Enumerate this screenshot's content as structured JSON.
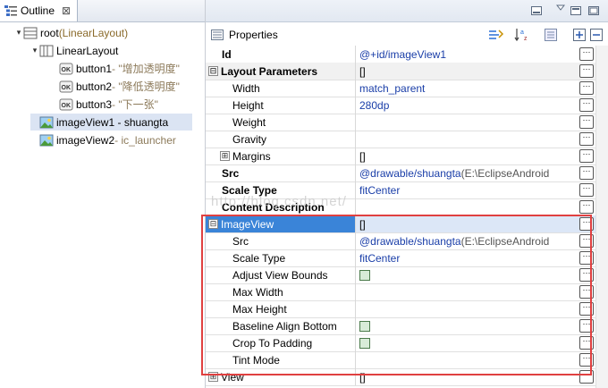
{
  "outline": {
    "tab_label": "Outline",
    "tab_close": "⊠",
    "tree": [
      {
        "label": "root",
        "sub": " (LinearLayout)",
        "indent": 0,
        "arrow": "▾",
        "icon": "layout-icon"
      },
      {
        "label": "LinearLayout",
        "sub": "",
        "indent": 1,
        "arrow": "▾",
        "icon": "linear-layout-icon"
      },
      {
        "label": "button1",
        "sub": " - \"增加透明度\"",
        "indent": 2,
        "arrow": "",
        "icon": "button-ok-icon"
      },
      {
        "label": "button2",
        "sub": " - \"降低透明度\"",
        "indent": 2,
        "arrow": "",
        "icon": "button-ok-icon"
      },
      {
        "label": "button3",
        "sub": " - \"下一张\"",
        "indent": 2,
        "arrow": "",
        "icon": "button-ok-icon"
      },
      {
        "label": "imageView1 - shuangta",
        "sub": "",
        "indent": 1,
        "arrow": "",
        "icon": "image-view-icon",
        "selected": true
      },
      {
        "label": "imageView2",
        "sub": " - ic_launcher",
        "indent": 1,
        "arrow": "",
        "icon": "image-view-icon"
      }
    ]
  },
  "properties": {
    "title": "Properties",
    "rows": [
      {
        "name": "Id",
        "value": "@+id/imageView1",
        "type": "bold"
      },
      {
        "name": "Layout Parameters",
        "value": "[]",
        "type": "cat",
        "expander": "⊟"
      },
      {
        "name": "Width",
        "value": "match_parent",
        "type": "child"
      },
      {
        "name": "Height",
        "value": "280dp",
        "type": "child"
      },
      {
        "name": "Weight",
        "value": "",
        "type": "child"
      },
      {
        "name": "Gravity",
        "value": "",
        "type": "child"
      },
      {
        "name": "Margins",
        "value": "[]",
        "type": "child-exp",
        "expander": "⊞"
      },
      {
        "name": "Src",
        "value": "@drawable/shuangta",
        "value_extra": " (E:\\EclipseAndroid",
        "type": "bold"
      },
      {
        "name": "Scale Type",
        "value": "fitCenter",
        "type": "bold"
      },
      {
        "name": "Content Description",
        "value": "",
        "type": "bold"
      },
      {
        "name": "ImageView",
        "value": "[]",
        "type": "sel",
        "expander": "⊟"
      },
      {
        "name": "Src",
        "value": "@drawable/shuangta",
        "value_extra": " (E:\\EclipseAndroid",
        "type": "child"
      },
      {
        "name": "Scale Type",
        "value": "fitCenter",
        "type": "child"
      },
      {
        "name": "Adjust View Bounds",
        "value": "",
        "checkbox": true,
        "type": "child"
      },
      {
        "name": "Max Width",
        "value": "",
        "type": "child"
      },
      {
        "name": "Max Height",
        "value": "",
        "type": "child"
      },
      {
        "name": "Baseline Align Bottom",
        "value": "",
        "checkbox": true,
        "type": "child"
      },
      {
        "name": "Crop To Padding",
        "value": "",
        "checkbox": true,
        "type": "child"
      },
      {
        "name": "Tint Mode",
        "value": "",
        "type": "child-last"
      },
      {
        "name": "View",
        "value": "[]",
        "type": "cat-plain",
        "expander": "⊞"
      }
    ],
    "button_glyph": "···"
  },
  "watermark": "http://blog.csdn.net/",
  "colors": {
    "highlight_box": "#e04040",
    "selected_row": "#3a84d8"
  }
}
